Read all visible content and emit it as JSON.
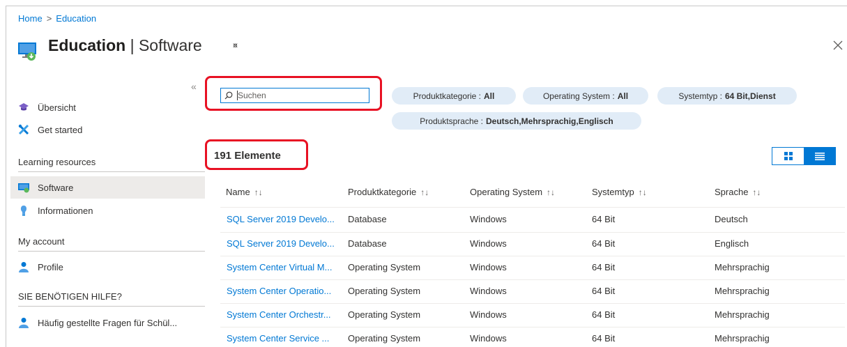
{
  "breadcrumb": {
    "home": "Home",
    "separator": ">",
    "current": "Education"
  },
  "header": {
    "title_bold": "Education",
    "title_separator": "|",
    "title_sub": "Software"
  },
  "sidebar": {
    "collapse_glyph": "«",
    "items_top": [
      {
        "label": "Übersicht",
        "icon": "graduation-cap-icon"
      },
      {
        "label": "Get started",
        "icon": "tools-icon"
      }
    ],
    "section_learning": "Learning resources",
    "items_learning": [
      {
        "label": "Software",
        "icon": "software-icon"
      },
      {
        "label": "Informationen",
        "icon": "info-icon"
      }
    ],
    "section_account": "My account",
    "items_account": [
      {
        "label": "Profile",
        "icon": "person-icon"
      }
    ],
    "section_help": "SIE BENÖTIGEN HILFE?",
    "items_help": [
      {
        "label": "Häufig gestellte Fragen für Schül...",
        "icon": "person-icon"
      }
    ]
  },
  "search": {
    "placeholder": "Suchen",
    "value": ""
  },
  "filters": [
    {
      "label": "Produktkategorie :",
      "value": "All"
    },
    {
      "label": "Operating System :",
      "value": "All"
    },
    {
      "label": "Systemtyp :",
      "value": "64 Bit,Dienst"
    },
    {
      "label": "Produktsprache :",
      "value": "Deutsch,Mehrsprachig,Englisch"
    }
  ],
  "results": {
    "count_label": "191 Elemente"
  },
  "table": {
    "sort_glyph": "↑↓",
    "columns": [
      "Name",
      "Produktkategorie",
      "Operating System",
      "Systemtyp",
      "Sprache"
    ],
    "rows": [
      [
        "SQL Server 2019 Develo...",
        "Database",
        "Windows",
        "64 Bit",
        "Deutsch"
      ],
      [
        "SQL Server 2019 Develo...",
        "Database",
        "Windows",
        "64 Bit",
        "Englisch"
      ],
      [
        "System Center Virtual M...",
        "Operating System",
        "Windows",
        "64 Bit",
        "Mehrsprachig"
      ],
      [
        "System Center Operatio...",
        "Operating System",
        "Windows",
        "64 Bit",
        "Mehrsprachig"
      ],
      [
        "System Center Orchestr...",
        "Operating System",
        "Windows",
        "64 Bit",
        "Mehrsprachig"
      ],
      [
        "System Center Service ...",
        "Operating System",
        "Windows",
        "64 Bit",
        "Mehrsprachig"
      ]
    ]
  },
  "colors": {
    "accent": "#0078d4",
    "highlight": "#e81123",
    "pill_bg": "#e1ecf7",
    "selected_bg": "#edebe9"
  }
}
